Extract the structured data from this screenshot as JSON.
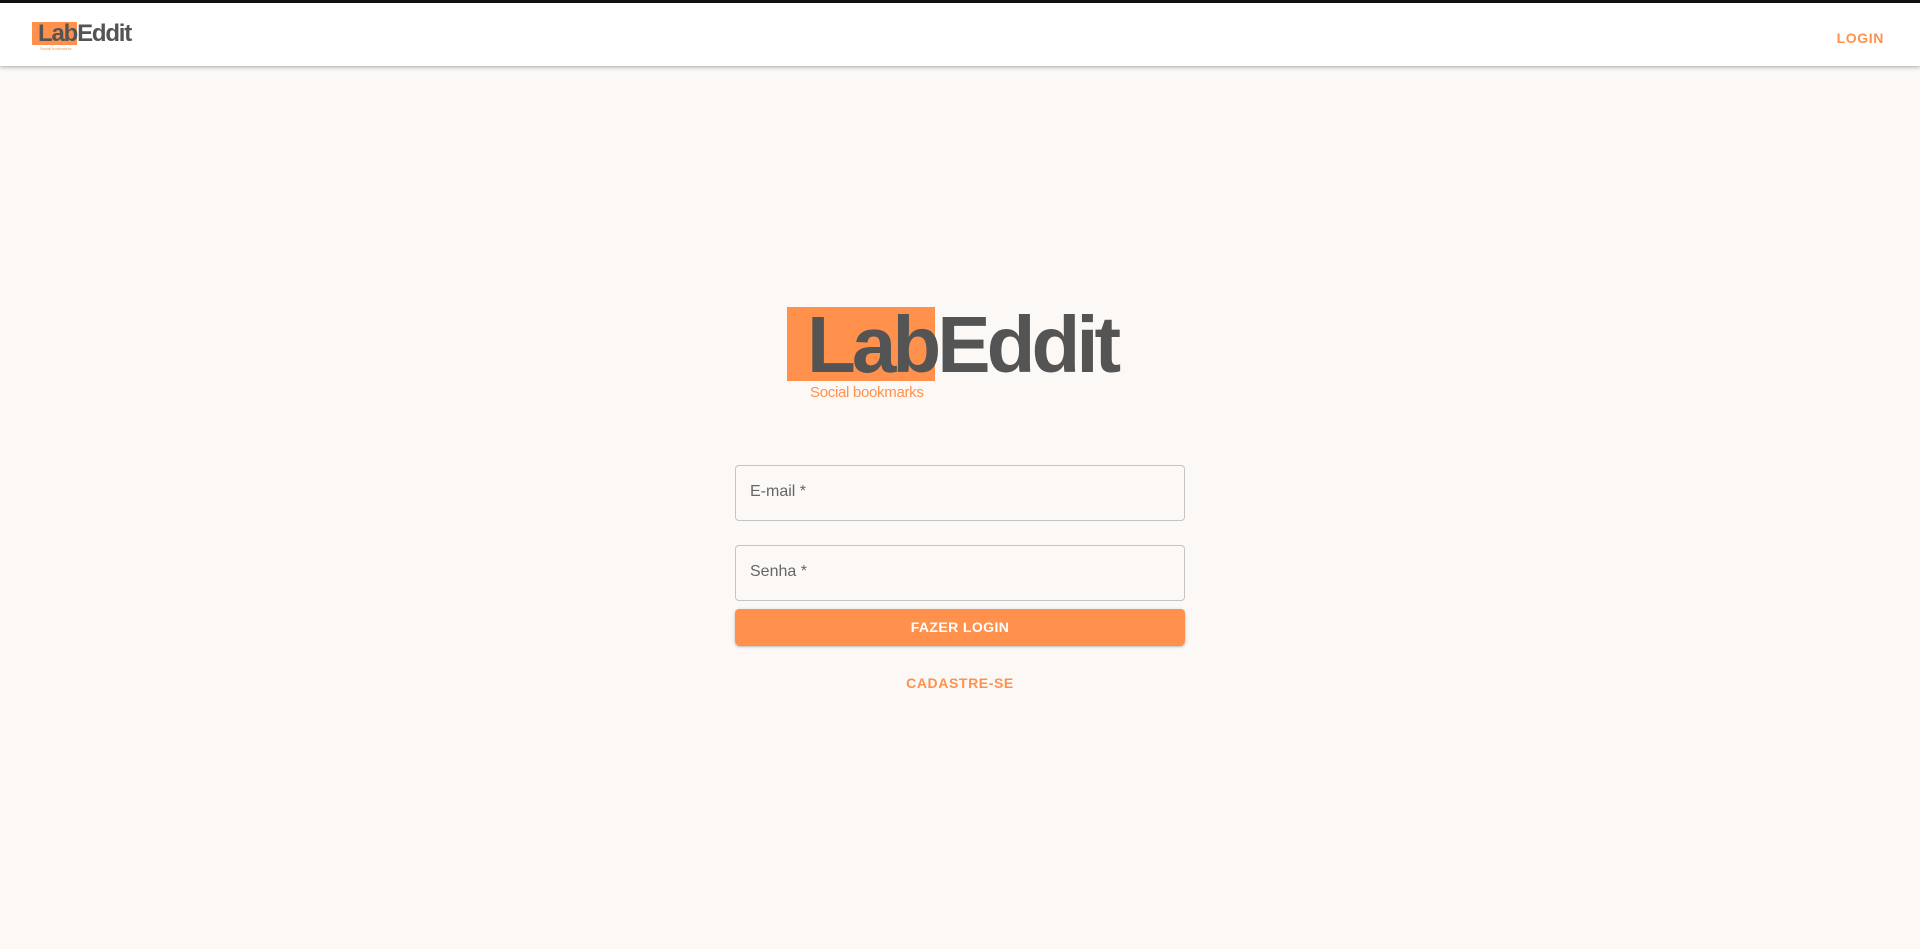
{
  "header": {
    "logo": {
      "wordmark": "LabEddit",
      "tagline": "Social bookmarks"
    },
    "login_label": "LOGIN"
  },
  "main": {
    "logo": {
      "wordmark": "LabEddit",
      "tagline": "Social bookmarks"
    },
    "form": {
      "email_label": "E-mail *",
      "password_label": "Senha *",
      "submit_label": "FAZER LOGIN",
      "signup_label": "CADASTRE-SE"
    }
  },
  "colors": {
    "accent": "#ff914d",
    "logo_text": "#545454",
    "background": "#fcf8f6"
  }
}
